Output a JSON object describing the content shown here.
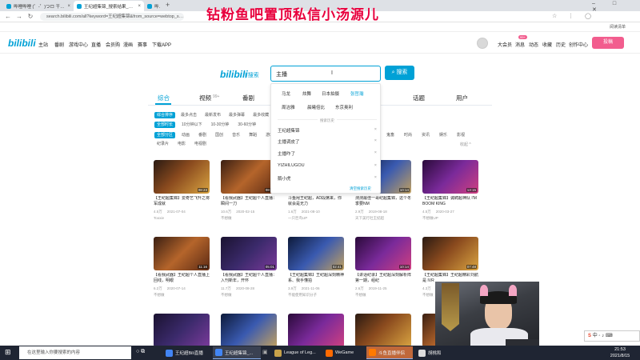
{
  "browser": {
    "tabs": [
      {
        "label": "哔哩哔哩 (゜-゜)つロ 干杯~-bili"
      },
      {
        "label": "王纪超集锦_搜索结果_哔哩哔"
      },
      {
        "label": "哔哩哔哩 (゜-゜)つロ 干杯~"
      }
    ],
    "url": "search.bilibili.com/all?keyword=王纪超集锦&from_source=webtop_search",
    "bookmarks_right": "阅读清单"
  },
  "overlay_title": "钻粉鱼吧置顶私信小汤源儿",
  "header": {
    "logo": "bilibili",
    "nav": [
      "主站",
      "番剧",
      "游戏中心",
      "直播",
      "会员购",
      "漫画",
      "赛事",
      "下载APP"
    ],
    "right": [
      "大会员",
      "消息",
      "动态",
      "收藏",
      "历史",
      "创作中心"
    ],
    "badge": "99+",
    "upload": "投稿"
  },
  "search": {
    "logo": "bilibili",
    "logo_suffix": "| 搜索",
    "value": "主播",
    "button": "搜索"
  },
  "suggestions": [
    "马龙",
    "炫舞",
    "日本拍摄",
    "张哲瀚",
    "周洁雅",
    "晨曦倍比",
    "东京奥利"
  ],
  "history_label": "搜索历史",
  "history": [
    "王纪超集锦",
    "主播调皮了",
    "主播咋了",
    "YIZHILUGOU",
    "鹅小虎"
  ],
  "clear_history": "清空搜索历史",
  "nav_tabs": [
    "综合",
    "视频",
    "番剧",
    "话题",
    "用户"
  ],
  "nav_counts": {
    "video": "99+"
  },
  "filters": {
    "row1": [
      "综合排序",
      "最多点击",
      "最新发布",
      "最多弹幕",
      "最多收藏"
    ],
    "row2": [
      "全部时长",
      "10分钟以下",
      "10-30分钟",
      "30-60分钟"
    ],
    "row3": [
      "全部分区",
      "动画",
      "番剧",
      "国创",
      "音乐",
      "舞蹈",
      "游戏"
    ],
    "row4": [
      "纪录片",
      "电影",
      "电视剧"
    ],
    "row3_right": [
      "鬼畜",
      "时尚",
      "资讯",
      "娱乐",
      "影视"
    ],
    "more": "收起"
  },
  "videos": [
    {
      "title": "【王纪超集锦】爱奇艺飞升之将军成就",
      "dur": "08:23",
      "views": "4.5万",
      "date": "2021-07-04",
      "up": "Tooxie"
    },
    {
      "title": "【看我武器】王纪超个人直播：瞬间一刀",
      "dur": "08:31",
      "views": "10.6万",
      "date": "2020-02-15",
      "up": "不想做"
    },
    {
      "title": "斗鱼甩王纪超，AD段席来，你就会是无力",
      "dur": "02:33",
      "views": "1.6万",
      "date": "2021-08-10",
      "up": "一只巨鸟UP"
    },
    {
      "title": "测测最佳一哥纪超集锦，这个冬季要NM",
      "dur": "10:14",
      "views": "2.9万",
      "date": "2019-08-18",
      "up": "天下美行社王纪超"
    },
    {
      "title": "【王纪超集锦】诚聘超神队 I'M BOOM KING",
      "dur": "13:15",
      "views": "4.5万",
      "date": "2020-03-27",
      "up": "不想做UP"
    },
    {
      "title": "【看我武器】王纪超个人直播上回线，明眼",
      "dur": "11:16",
      "views": "6.2万",
      "date": "2020-07-14",
      "up": "不想做"
    },
    {
      "title": "【看我武器】王纪超个人直播：入刊新年，开怀",
      "dur": "05:01",
      "views": "11.7万",
      "date": "2020-08-28",
      "up": "不想做"
    },
    {
      "title": "【王纪超集锦】王纪超深刻精神系、我手懂拍",
      "dur": "02:41",
      "views": "3.9万",
      "date": "2021-11-06",
      "up": "不能使用知识分子"
    },
    {
      "title": "【讲话纪录】王纪超深刻解析阵第一期，组纪",
      "dur": "10:14",
      "views": "2.6万",
      "date": "2019-11-25",
      "up": "不想做"
    },
    {
      "title": "【王纪超集锦】王纪超精彩刘航是 IVR",
      "dur": "07:48",
      "views": "4.3万",
      "date": "2021-05-02",
      "up": "不想做"
    },
    {
      "title": "",
      "dur": "",
      "views": "",
      "date": "",
      "up": ""
    },
    {
      "title": "",
      "dur": "",
      "views": "",
      "date": "",
      "up": ""
    },
    {
      "title": "",
      "dur": "",
      "views": "",
      "date": "",
      "up": ""
    },
    {
      "title": "",
      "dur": "",
      "views": "",
      "date": "",
      "up": ""
    },
    {
      "title": "",
      "dur": "",
      "views": "",
      "date": "",
      "up": ""
    }
  ],
  "taskbar": {
    "search_placeholder": "在这里输入你要搜索的内容",
    "items": [
      "王纪超Bili直播",
      "王纪超集锦_...",
      "League of Leg...",
      "WeGame",
      "斗鱼直播伴侣",
      "胡桃和"
    ],
    "time": "21:53",
    "date": "2021/8/15"
  },
  "ime": "中"
}
